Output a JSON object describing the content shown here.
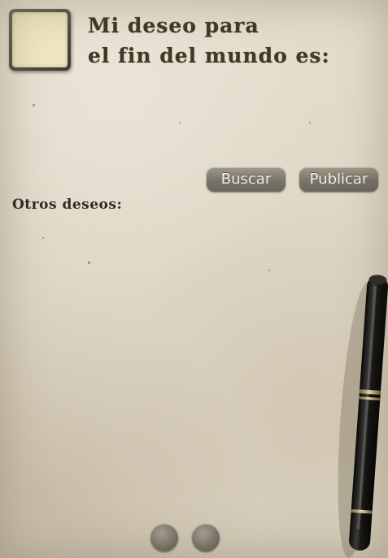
{
  "header": {
    "title_line1": "Mi deseo para",
    "title_line2": "el fin del mundo es:"
  },
  "actions": {
    "search_label": "Buscar",
    "publish_label": "Publicar"
  },
  "others": {
    "label": "Otros deseos:",
    "items": []
  },
  "pagination": {
    "dots": 2
  },
  "colors": {
    "paper": "#e3dccb",
    "title_ink": "#3e3a25",
    "button_fill": "#7d7a6e",
    "button_text": "#f3f0e4",
    "avatar_fill": "#efe7c0"
  },
  "icons": {
    "decoration": "fountain-pen-icon"
  }
}
